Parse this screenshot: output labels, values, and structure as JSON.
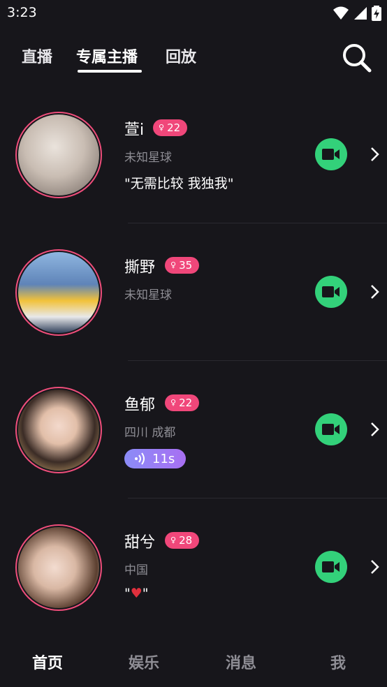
{
  "status": {
    "time": "3:23",
    "icons": [
      "wifi-icon",
      "signal-icon",
      "battery-charging-icon"
    ]
  },
  "tabs": [
    {
      "label": "直播"
    },
    {
      "label": "专属主播"
    },
    {
      "label": "回放"
    }
  ],
  "active_tab": "专属主播",
  "hosts": [
    {
      "name": "萱i",
      "level": "22",
      "location": "未知星球",
      "signature": "\"无需比较 我独我\"",
      "voice": "",
      "avatar_colors": [
        "#d8cfc8",
        "#8a7f78"
      ]
    },
    {
      "name": "撕野",
      "level": "35",
      "location": "未知星球",
      "signature": "",
      "voice": "",
      "avatar_colors": [
        "#7fa8d8",
        "#f1c338"
      ]
    },
    {
      "name": "鱼郁",
      "level": "22",
      "location": "四川 成都",
      "signature": "",
      "voice": "11s",
      "avatar_colors": [
        "#3b2c26",
        "#e9c07b"
      ]
    },
    {
      "name": "甜兮",
      "level": "28",
      "location": "中国",
      "signature_prefix": "\"",
      "signature_heart": "♥",
      "signature_suffix": "\"",
      "voice": "",
      "avatar_colors": [
        "#5b3f30",
        "#e8d7c7"
      ]
    }
  ],
  "bottom_nav": [
    {
      "label": "首页"
    },
    {
      "label": "娱乐"
    },
    {
      "label": "消息"
    },
    {
      "label": "我"
    }
  ],
  "colors": {
    "accent_pink": "#f0477a",
    "video_green": "#33d17a",
    "background": "#17161b"
  }
}
